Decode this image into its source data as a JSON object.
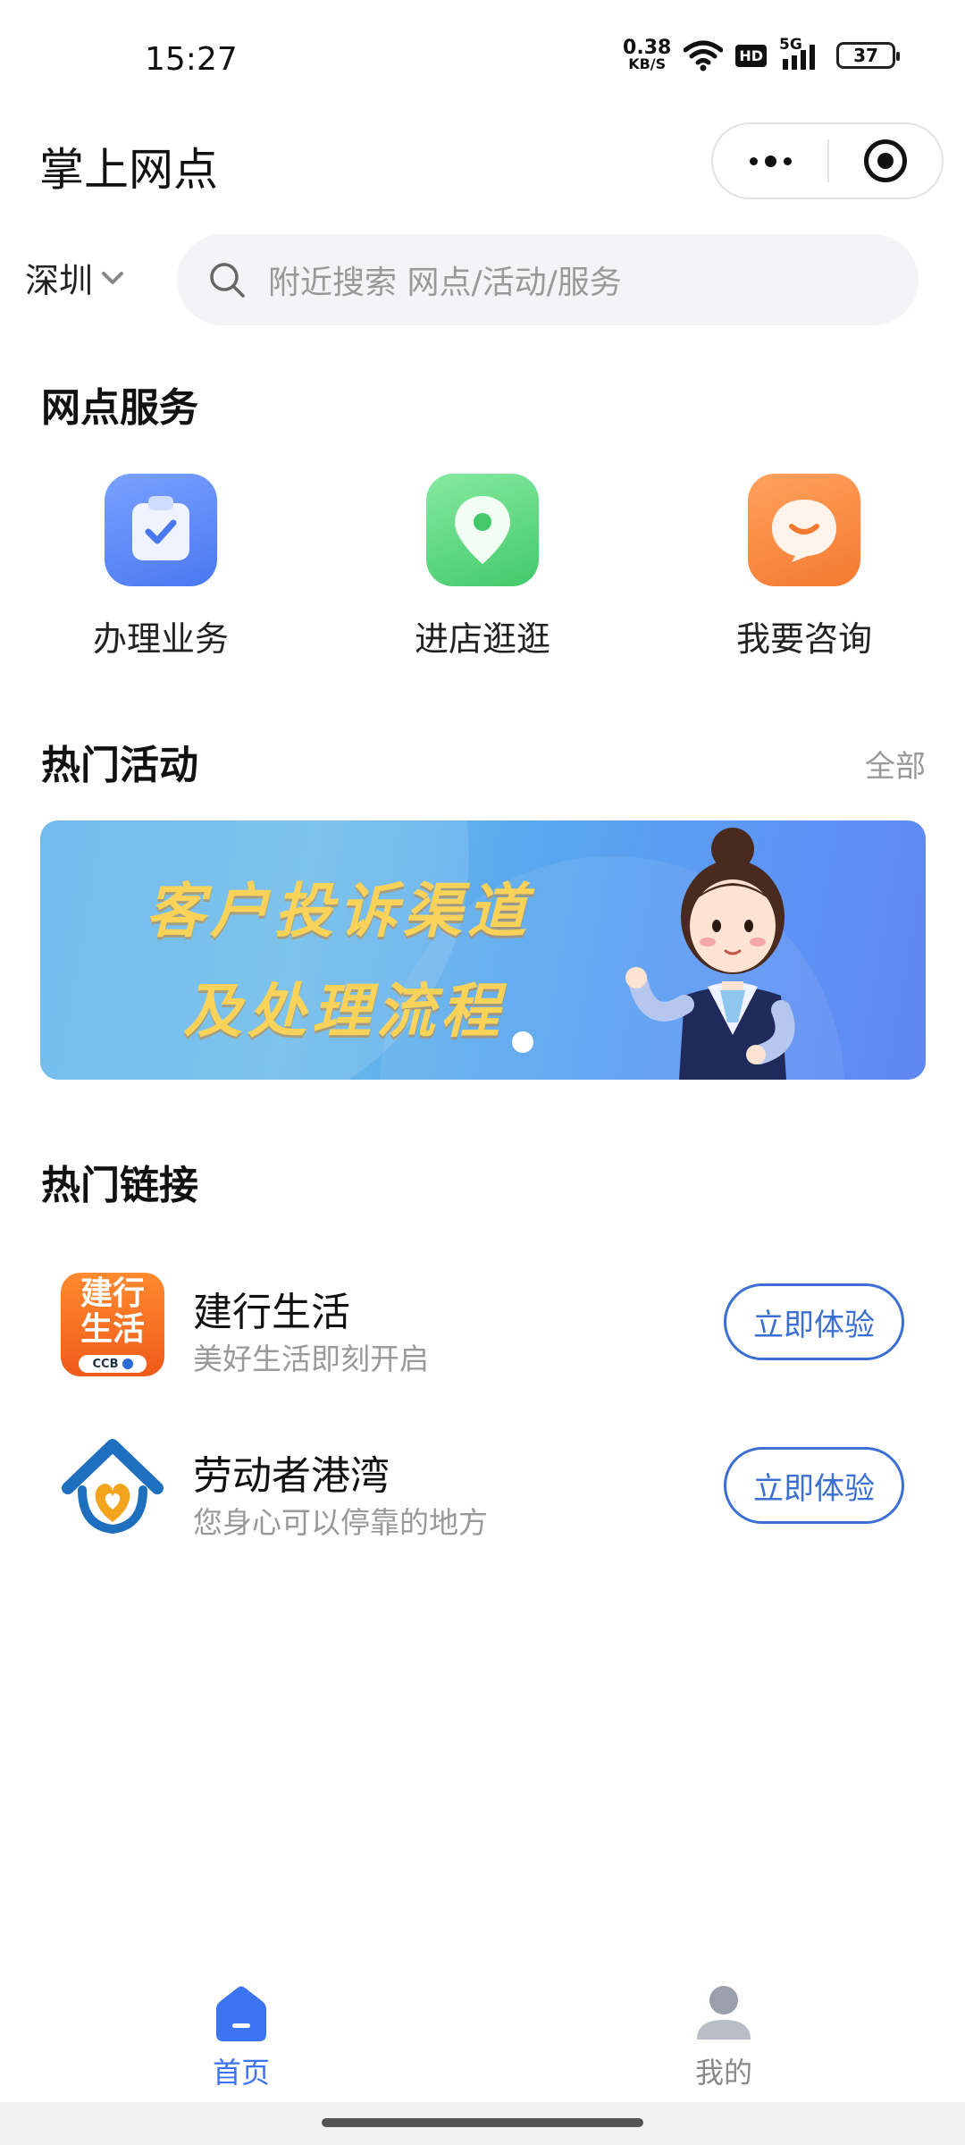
{
  "status_bar": {
    "time": "15:27",
    "net_speed_value": "0.38",
    "net_speed_unit": "KB/S",
    "hd_label": "HD",
    "network_label": "5G",
    "battery_level": "37"
  },
  "header": {
    "title": "掌上网点"
  },
  "search": {
    "city": "深圳",
    "placeholder": "附近搜索 网点/活动/服务"
  },
  "services": {
    "title": "网点服务",
    "items": [
      {
        "label": "办理业务",
        "icon": "clipboard-check-icon",
        "color": "#5b86f7"
      },
      {
        "label": "进店逛逛",
        "icon": "location-pin-icon",
        "color": "#5ed882"
      },
      {
        "label": "我要咨询",
        "icon": "chat-bubble-icon",
        "color": "#f98a3d"
      }
    ]
  },
  "activities": {
    "title": "热门活动",
    "all_label": "全部",
    "banner": {
      "line1": "客户投诉渠道",
      "line2": "及处理流程"
    }
  },
  "links": {
    "title": "热门链接",
    "items": [
      {
        "name": "建行生活",
        "desc": "美好生活即刻开启",
        "button": "立即体验",
        "logo_line1": "建行",
        "logo_line2": "生活",
        "logo_badge": "CCB"
      },
      {
        "name": "劳动者港湾",
        "desc": "您身心可以停靠的地方",
        "button": "立即体验"
      }
    ]
  },
  "tabbar": {
    "items": [
      {
        "label": "首页",
        "active": true
      },
      {
        "label": "我的",
        "active": false
      }
    ],
    "active_color": "#3b73f0",
    "inactive_color": "#888888"
  }
}
